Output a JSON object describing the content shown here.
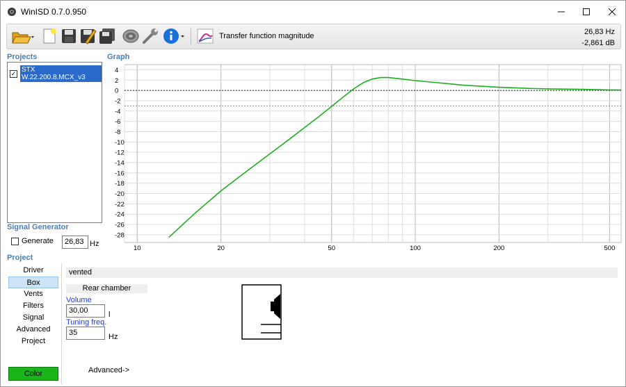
{
  "window": {
    "title": "WinISD 0.7.0.950"
  },
  "toolbar": {
    "icons": [
      "open-folder-icon",
      "new-document-icon",
      "save-icon",
      "save-as-icon",
      "save-all-icon",
      "driver-icon",
      "wrench-icon",
      "info-icon",
      "graph-icon"
    ],
    "graph_type_label": "Transfer function magnitude"
  },
  "readout": {
    "frequency": "26,83 Hz",
    "level": "-2,861 dB"
  },
  "sections": {
    "projects": "Projects",
    "graph": "Graph",
    "signal_generator": "Signal Generator",
    "project": "Project"
  },
  "projects": [
    {
      "name": "STX W.22.200.8.MCX_v3",
      "checked": true
    }
  ],
  "signal_generator": {
    "generate_label": "Generate",
    "generate_checked": false,
    "frequency": "26,83",
    "unit": "Hz"
  },
  "project_nav": {
    "items": [
      "Driver",
      "Box",
      "Vents",
      "Filters",
      "Signal",
      "Advanced",
      "Project"
    ],
    "active": "Box",
    "color_button": "Color"
  },
  "box_panel": {
    "box_type": "vented",
    "chamber_label": "Rear chamber",
    "volume_label": "Volume",
    "volume_value": "30,00",
    "volume_unit": "l",
    "tuning_label": "Tuning freq.",
    "tuning_value": "35",
    "tuning_unit": "Hz",
    "advanced_link": "Advanced->"
  },
  "colors": {
    "curve": "#1fae1f",
    "accent": "#4a7fb5",
    "color_button": "#19b519",
    "selection": "#2a6acb"
  },
  "chart_data": {
    "type": "line",
    "title": "",
    "xlabel": "",
    "ylabel": "",
    "x_scale": "log",
    "xlim": [
      9,
      550
    ],
    "ylim": [
      -29.5,
      5
    ],
    "x_ticks": [
      10,
      20,
      50,
      100,
      200,
      500
    ],
    "y_ticks": [
      4,
      2,
      0,
      -2,
      -4,
      -6,
      -8,
      -10,
      -12,
      -14,
      -16,
      -18,
      -20,
      -22,
      -24,
      -26,
      -28
    ],
    "grid": true,
    "reference_lines": [
      {
        "y": 0,
        "style": "dotted"
      },
      {
        "y": -3,
        "style": "dotted"
      }
    ],
    "series": [
      {
        "x": [
          13,
          16,
          20,
          25,
          30,
          35,
          40,
          45,
          50,
          55,
          60,
          65,
          70,
          75,
          80,
          90,
          100,
          120,
          150,
          200,
          250,
          300,
          400,
          500,
          550
        ],
        "y": [
          -28.5,
          -24,
          -19.5,
          -15.5,
          -12.3,
          -9.6,
          -7.2,
          -5.1,
          -3.1,
          -1.3,
          0.3,
          1.5,
          2.2,
          2.5,
          2.5,
          2.2,
          1.9,
          1.5,
          1.0,
          0.6,
          0.4,
          0.3,
          0.2,
          0.1,
          0.1
        ]
      }
    ]
  }
}
